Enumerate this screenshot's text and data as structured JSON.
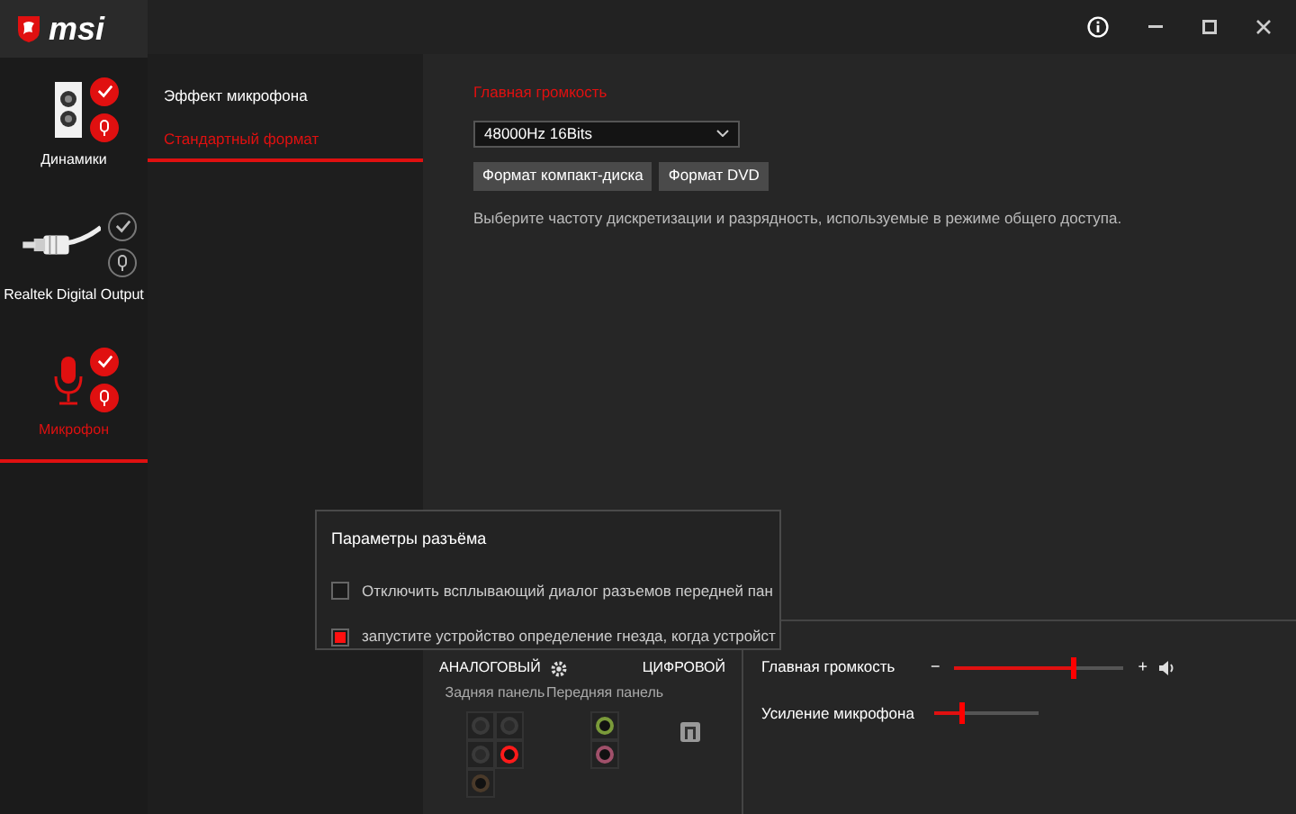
{
  "logo": {
    "text": "msi"
  },
  "title_bar": {
    "buttons": [
      {
        "kind": "info"
      },
      {
        "kind": "minimize"
      },
      {
        "kind": "maximize"
      },
      {
        "kind": "close"
      }
    ]
  },
  "devices": [
    {
      "name": "Динамики",
      "kind": "speaker",
      "default": true,
      "default_comm": true,
      "selected": false
    },
    {
      "name": "Realtek Digital Output",
      "kind": "optical",
      "default": false,
      "default_comm": false,
      "selected": false
    },
    {
      "name": "Микрофон",
      "kind": "microphone",
      "default": true,
      "default_comm": true,
      "selected": true
    }
  ],
  "tabs": [
    {
      "label": "Эффект микрофона",
      "selected": false
    },
    {
      "label": "Стандартный формат",
      "selected": true
    }
  ],
  "format": {
    "heading": "Главная громкость",
    "value": "48000Hz 16Bits",
    "buttons": [
      "Формат компакт-диска",
      "Формат DVD"
    ],
    "description": "Выберите частоту дискретизации и разрядность, используемые в режиме общего доступа."
  },
  "jack_dialog": {
    "title": "Параметры разъёма",
    "options": [
      {
        "label": "Отключить всплывающий диалог разъемов передней пан",
        "checked": false
      },
      {
        "label": "запустите устройство определение гнезда, когда  устройст",
        "checked": true
      }
    ]
  },
  "jacks": {
    "analog_label": "АНАЛОГОВЫЙ",
    "digital_label": "ЦИФРОВОЙ",
    "rear_label": "Задняя панель",
    "front_label": "Передняя панель",
    "rear": [
      {
        "active": false,
        "color": "#3a3a3a"
      },
      {
        "active": false,
        "color": "#3a3a3a"
      },
      {
        "active": false,
        "color": "#3a3a3a"
      },
      {
        "active": true,
        "color": "#ff1a1a"
      },
      {
        "active": true,
        "color": "#4a3a2a"
      }
    ],
    "front": [
      {
        "active": true,
        "color": "#7a9a3a"
      },
      {
        "active": true,
        "color": "#a0506a"
      }
    ]
  },
  "levels": [
    {
      "label": "Главная громкость",
      "kind": "volume",
      "level": 0.7,
      "minus": "−",
      "plus": "+"
    },
    {
      "label": "Усиление микрофона",
      "kind": "boost",
      "level": 0.25
    }
  ]
}
